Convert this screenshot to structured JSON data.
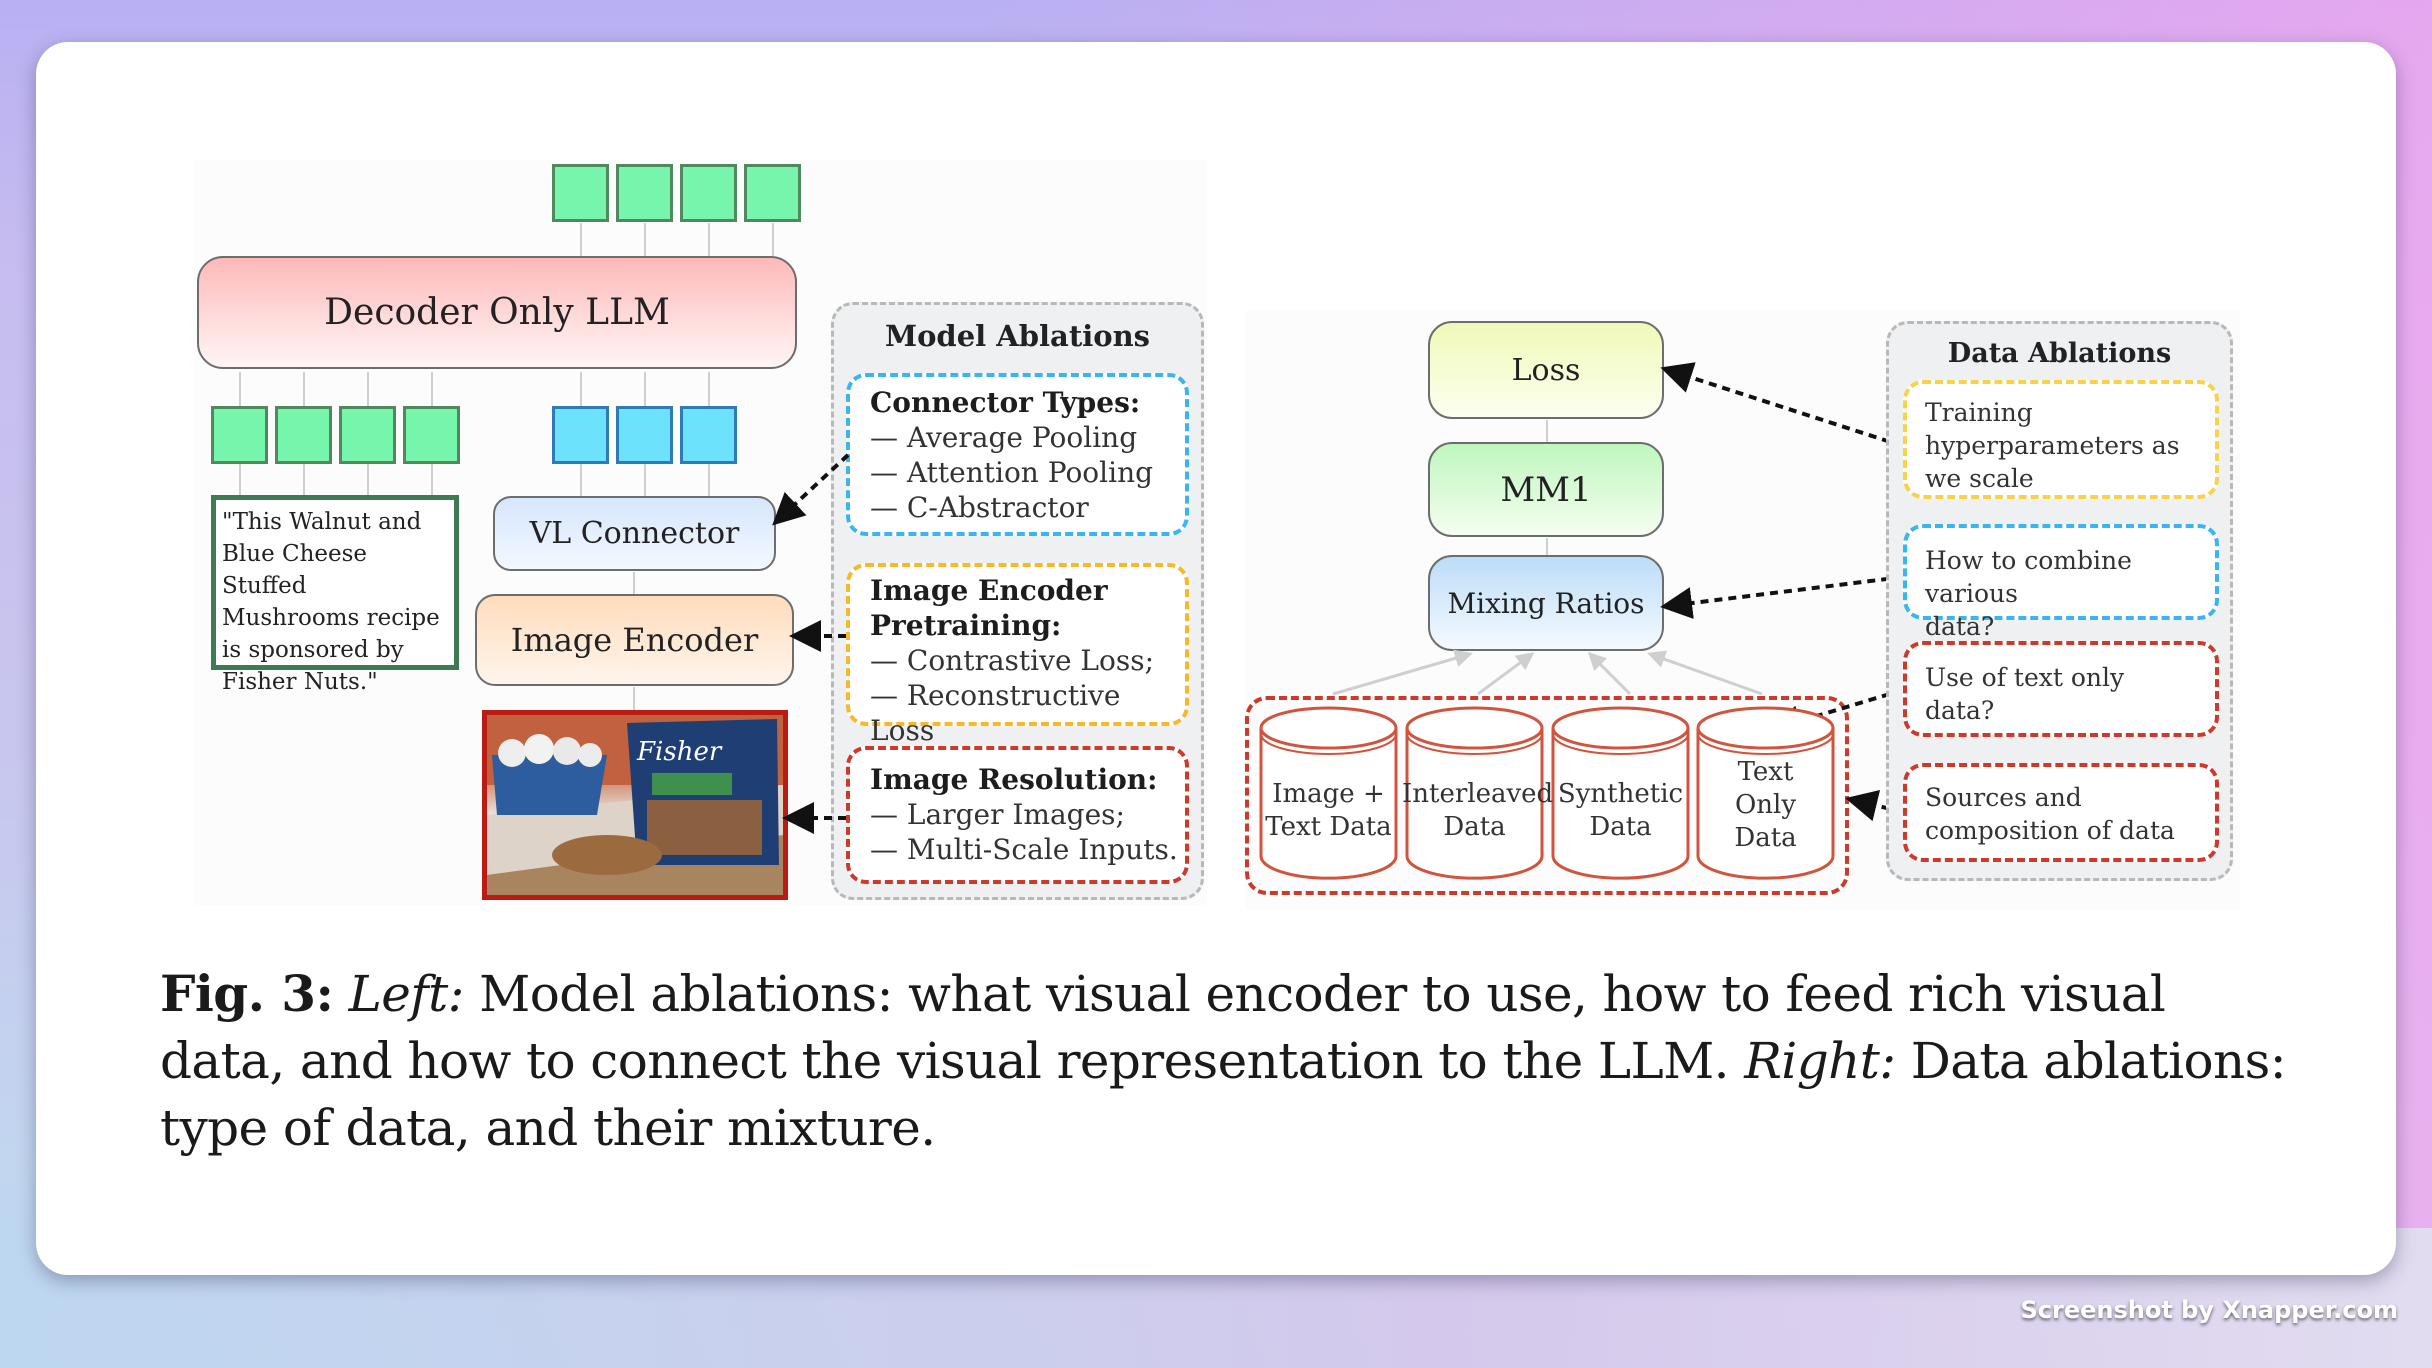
{
  "left_figure": {
    "output_tokens": {
      "count": 4,
      "color": "#78f5ac"
    },
    "llm_label": "Decoder Only LLM",
    "text_tokens": {
      "count": 4,
      "color": "#78f5ac"
    },
    "image_tokens": {
      "count": 3,
      "color": "#6ce2fc"
    },
    "text_input": "\"This Walnut and Blue Cheese Stuffed Mushrooms recipe is sponsored by Fisher Nuts.\"",
    "vl_connector_label": "VL Connector",
    "image_encoder_label": "Image Encoder",
    "photo_description": "Mushrooms in a blue tray and a bag of Fisher walnuts on a cutting board",
    "photo_brand": "Fisher",
    "model_ablations": {
      "title": "Model Ablations",
      "groups": [
        {
          "heading": "Connector Types:",
          "items": [
            "— Average Pooling",
            "— Attention Pooling",
            "— C-Abstractor"
          ],
          "color": "#3bb4f2"
        },
        {
          "heading": "Image Encoder Pretraining:",
          "heading_lines": [
            "Image Encoder",
            "Pretraining:"
          ],
          "items": [
            "— Contrastive Loss;",
            "— Reconstructive Loss"
          ],
          "color": "#f7b82a"
        },
        {
          "heading": "Image Resolution:",
          "items": [
            "— Larger Images;",
            "— Multi-Scale Inputs."
          ],
          "color": "#cc3a2c"
        }
      ]
    }
  },
  "right_figure": {
    "loss_label": "Loss",
    "mm1_label": "MM1",
    "mixing_label": "Mixing Ratios",
    "datasets": [
      {
        "lines": [
          "Image +",
          "Text Data"
        ]
      },
      {
        "lines": [
          "Interleaved",
          "Data"
        ]
      },
      {
        "lines": [
          "Synthetic",
          "Data"
        ]
      },
      {
        "lines": [
          "Text",
          "Only",
          "Data"
        ]
      }
    ],
    "data_ablations": {
      "title": "Data Ablations",
      "items": [
        {
          "lines": [
            "Training",
            "hyperparameters as",
            "we scale"
          ],
          "color": "#f7d24a"
        },
        {
          "lines": [
            "How to combine various",
            "data?"
          ],
          "color": "#3bb4f2"
        },
        {
          "lines": [
            "Use of text only",
            "data?"
          ],
          "color": "#cc3a2c"
        },
        {
          "lines": [
            "Sources and",
            "composition of data"
          ],
          "color": "#cc3a2c"
        }
      ]
    }
  },
  "caption": {
    "fig_label": "Fig. 3:",
    "left_label": "Left:",
    "left_text": " Model ablations: what visual encoder to use, how to feed rich visual data, and how to connect the visual representation to the LLM. ",
    "right_label": "Right:",
    "right_text": " Data ablations: type of data, and their mixture."
  },
  "watermark": "Screenshot by Xnapper.com",
  "colors": {
    "card": "#ffffff",
    "token_green": "#78f5ac",
    "token_blue": "#6ce2fc",
    "cylinder_red": "#d0553f"
  }
}
